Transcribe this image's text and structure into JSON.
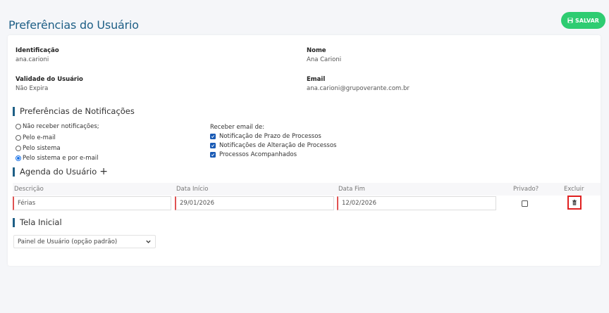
{
  "header": {
    "title": "Preferências do Usuário",
    "save_label": "SALVAR"
  },
  "user": {
    "id_label": "Identificação",
    "id_value": "ana.carioni",
    "name_label": "Nome",
    "name_value": "Ana Carioni",
    "validity_label": "Validade do Usuário",
    "validity_value": "Não Expira",
    "email_label": "Email",
    "email_value": "ana.carioni@grupoverante.com.br"
  },
  "notifications": {
    "section_title": "Preferências de Notificações",
    "options": [
      {
        "label": "Não receber notificações;",
        "checked": false
      },
      {
        "label": "Pelo e-mail",
        "checked": false
      },
      {
        "label": "Pelo sistema",
        "checked": false
      },
      {
        "label": "Pelo sistema e por e-mail",
        "checked": true
      }
    ],
    "email_heading": "Receber email de:",
    "email_options": [
      {
        "label": "Notificação de Prazo de Processos",
        "checked": true
      },
      {
        "label": "Notificações de Alteração de Processos",
        "checked": true
      },
      {
        "label": "Processos Acompanhados",
        "checked": true
      }
    ]
  },
  "agenda": {
    "section_title": "Agenda do Usuário",
    "add_symbol": "+",
    "columns": {
      "descricao": "Descrição",
      "inicio": "Data Início",
      "fim": "Data Fim",
      "privado": "Privado?",
      "excluir": "Excluir"
    },
    "row": {
      "descricao": "Férias",
      "inicio": "29/01/2026",
      "fim": "12/02/2026",
      "privado": false
    }
  },
  "home": {
    "section_title": "Tela Inicial",
    "selected": "Painel de Usuário (opção padrão)"
  }
}
